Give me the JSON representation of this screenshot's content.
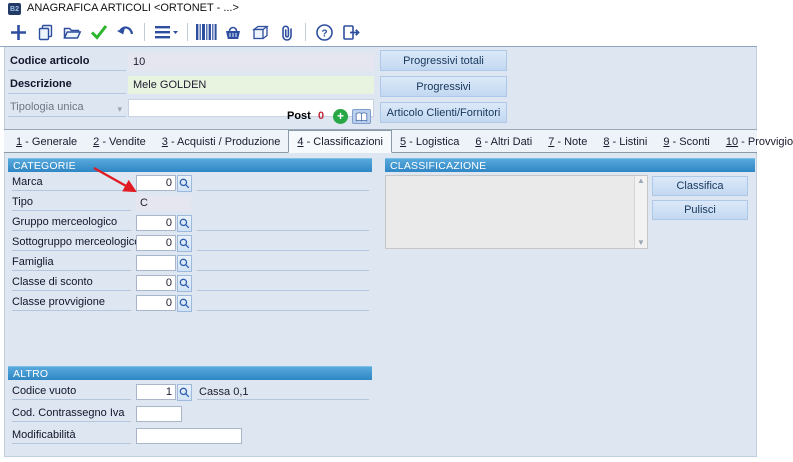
{
  "window": {
    "title": "ANAGRAFICA ARTICOLI <ORTONET - ...>",
    "app_icon_text": "B2"
  },
  "toolbar": {
    "icons": [
      "new-icon",
      "copy-icon",
      "open-folder-icon",
      "save-check-icon",
      "undo-icon",
      "menu-icon",
      "barcode-icon",
      "basket-icon",
      "package-icon",
      "paperclip-icon",
      "help-icon",
      "exit-icon"
    ]
  },
  "header_form": {
    "fields": [
      {
        "label": "Codice articolo",
        "value": "10"
      },
      {
        "label": "Descrizione",
        "value": "Mele GOLDEN"
      },
      {
        "label": "Tipologia unica",
        "value": ""
      }
    ],
    "post_label": "Post",
    "post_count": "0"
  },
  "side_buttons": [
    {
      "label": "Progressivi totali"
    },
    {
      "label": "Progressivi"
    },
    {
      "label": "Articolo Clienti/Fornitori"
    }
  ],
  "tabs": [
    {
      "num": "1",
      "rest": " - Generale"
    },
    {
      "num": "2",
      "rest": " - Vendite"
    },
    {
      "num": "3",
      "rest": " - Acquisti / Produzione"
    },
    {
      "num": "4",
      "rest": " - Classificazioni"
    },
    {
      "num": "5",
      "rest": " - Logistica"
    },
    {
      "num": "6",
      "rest": " - Altri Dati"
    },
    {
      "num": "7",
      "rest": " - Note"
    },
    {
      "num": "8",
      "rest": " - Listini"
    },
    {
      "num": "9",
      "rest": " - Sconti"
    },
    {
      "num": "10",
      "rest": " - Provvigioni"
    }
  ],
  "categorie": {
    "title": "CATEGORIE",
    "rows": [
      {
        "label": "Marca",
        "value": "0"
      },
      {
        "label": "Tipo",
        "value": "C"
      },
      {
        "label": "Gruppo merceologico",
        "value": "0"
      },
      {
        "label": "Sottogruppo merceologico",
        "value": "0"
      },
      {
        "label": "Famiglia",
        "value": ""
      },
      {
        "label": "Classe di sconto",
        "value": "0"
      },
      {
        "label": "Classe provvigione",
        "value": "0"
      }
    ]
  },
  "classificazione": {
    "title": "CLASSIFICAZIONE",
    "buttons": [
      {
        "label": "Classifica"
      },
      {
        "label": "Pulisci"
      }
    ]
  },
  "altro": {
    "title": "ALTRO",
    "rows": [
      {
        "label": "Codice vuoto",
        "value": "1",
        "desc": "Cassa 0,1"
      },
      {
        "label": "Cod. Contrassegno Iva",
        "value": ""
      },
      {
        "label": "Modificabilità",
        "value": ""
      }
    ]
  },
  "colors": {
    "accent_header_blue": "#2e86c4",
    "toolbar_icon_blue": "#2e4f9f",
    "save_check_green": "#2db52d",
    "post_count_red": "#c2293a",
    "description_bg_green": "#e9f4e0",
    "window_bg": "#dde6f1",
    "annotation_arrow_red": "#e11b22"
  }
}
